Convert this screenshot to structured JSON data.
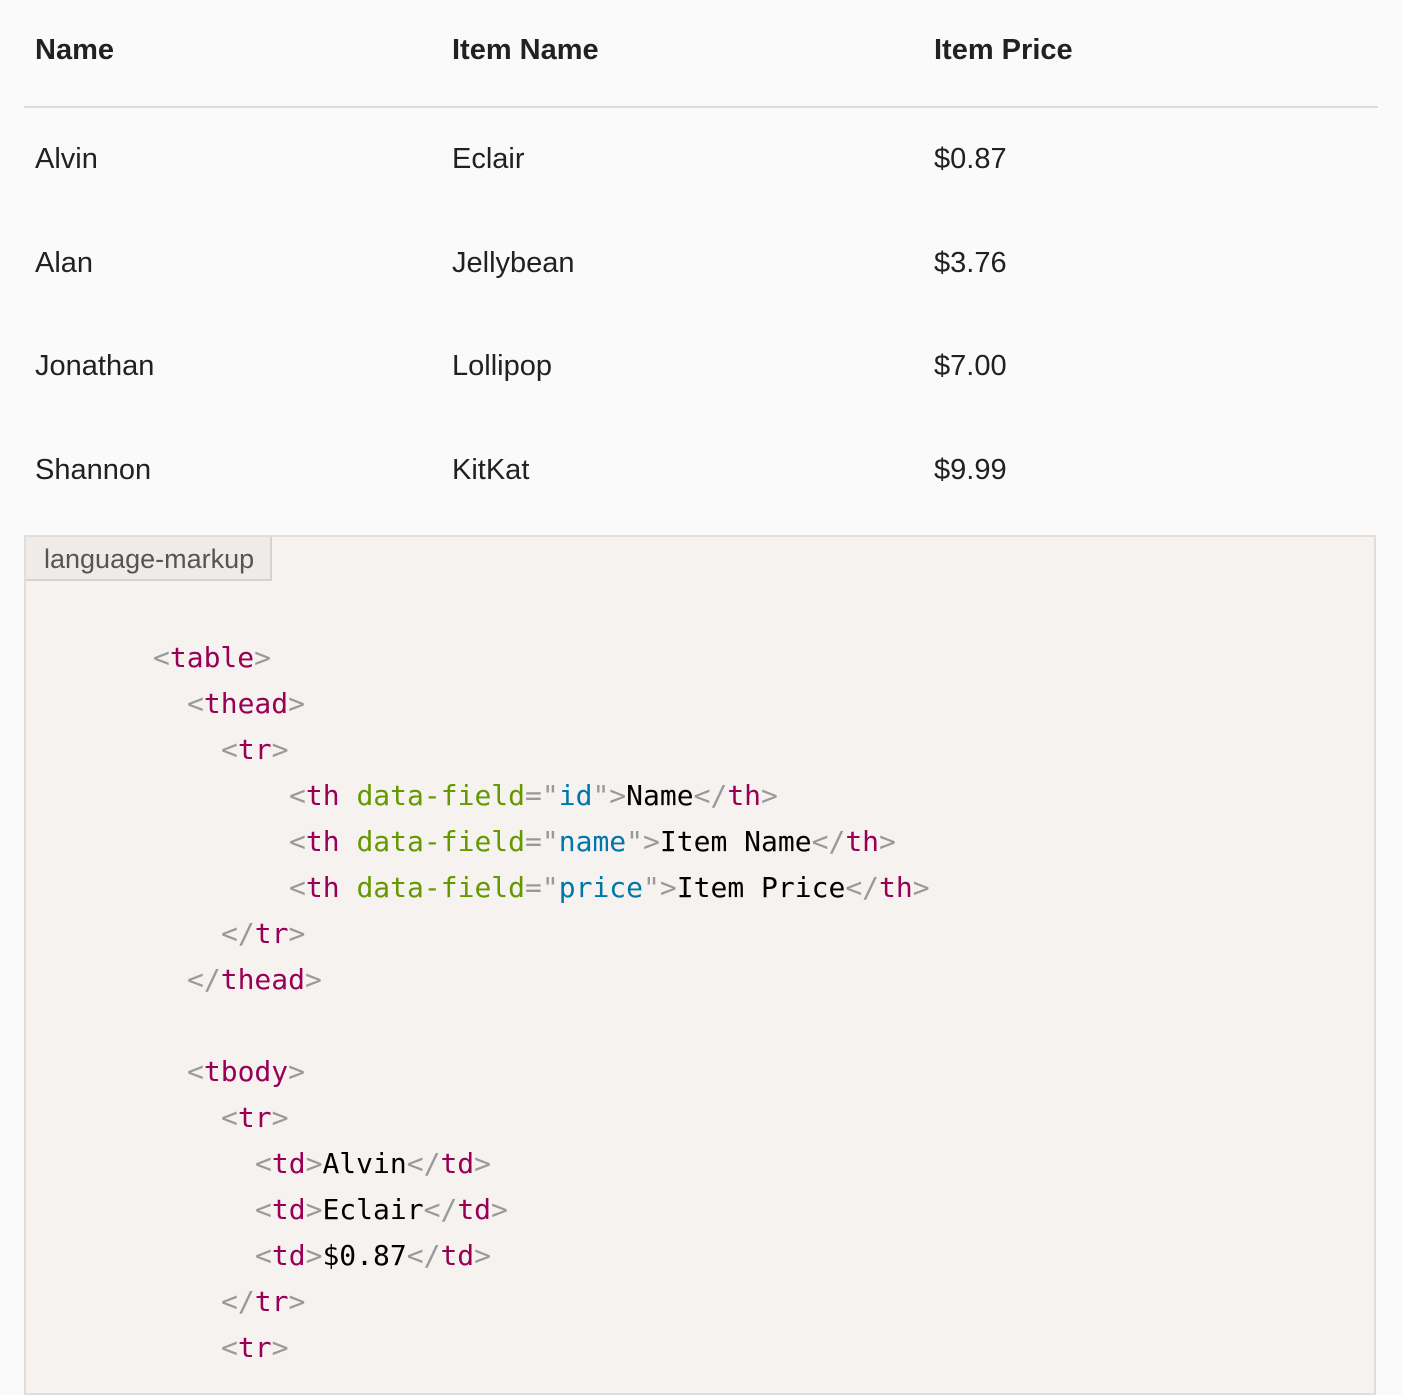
{
  "table": {
    "headers": [
      "Name",
      "Item Name",
      "Item Price"
    ],
    "rows": [
      [
        "Alvin",
        "Eclair",
        "$0.87"
      ],
      [
        "Alan",
        "Jellybean",
        "$3.76"
      ],
      [
        "Jonathan",
        "Lollipop",
        "$7.00"
      ],
      [
        "Shannon",
        "KitKat",
        "$9.99"
      ]
    ]
  },
  "code": {
    "language_label": "language-markup",
    "lines": [
      [
        "<",
        "table",
        ">"
      ],
      [
        "<",
        "thead",
        ">"
      ],
      [
        "<",
        "tr",
        ">"
      ],
      [
        "<",
        "th",
        "data-field",
        "id",
        "Name",
        "th"
      ],
      [
        "<",
        "th",
        "data-field",
        "name",
        "Item Name",
        "th"
      ],
      [
        "<",
        "th",
        "data-field",
        "price",
        "Item Price",
        "th"
      ],
      [
        "</",
        "tr",
        ">"
      ],
      [
        "</",
        "thead",
        ">"
      ],
      [
        "<",
        "tbody",
        ">"
      ],
      [
        "<",
        "tr",
        ">"
      ],
      [
        "td",
        "Alvin"
      ],
      [
        "td",
        "Eclair"
      ],
      [
        "td",
        "$0.87"
      ],
      [
        "</",
        "tr",
        ">"
      ],
      [
        "<",
        "tr",
        ">"
      ]
    ]
  },
  "colors": {
    "punctuation": "#999999",
    "tag": "#990055",
    "attr_name": "#669900",
    "attr_value": "#0077aa",
    "code_background": "#f5f2f0"
  }
}
